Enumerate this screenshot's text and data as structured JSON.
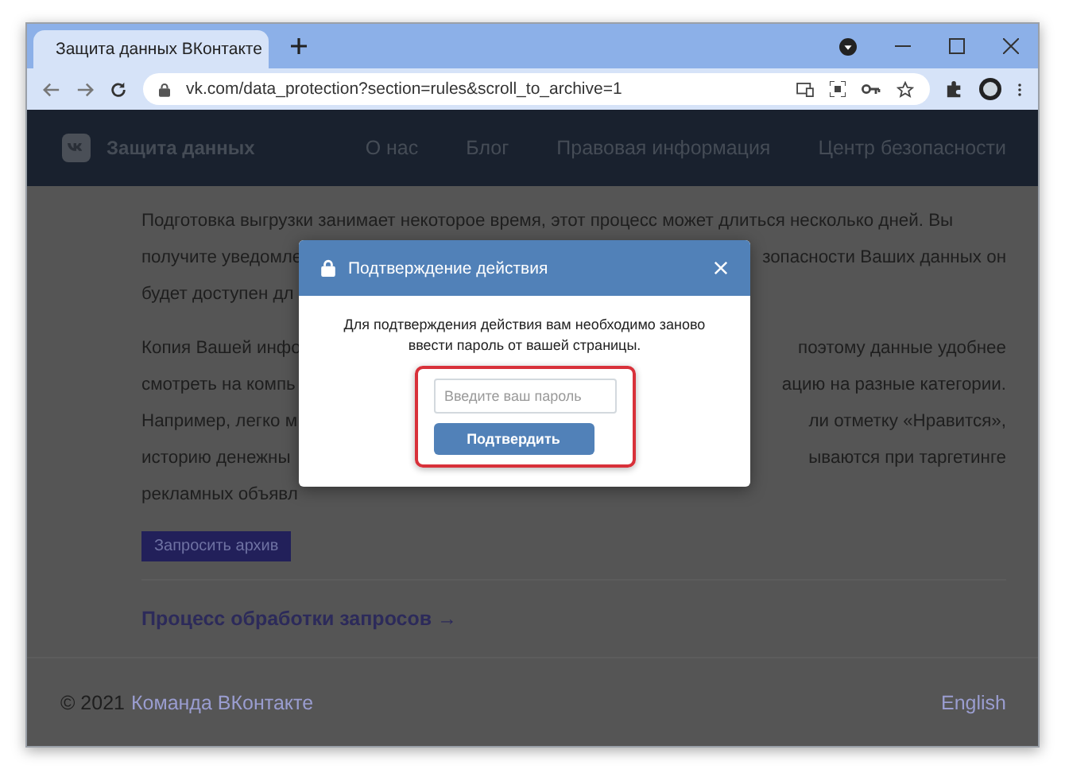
{
  "browser": {
    "tab_title": "Защита данных ВКонтакте",
    "url": "vk.com/data_protection?section=rules&scroll_to_archive=1"
  },
  "site_header": {
    "title": "Защита данных",
    "nav": [
      "О нас",
      "Блог",
      "Правовая информация",
      "Центр безопасности"
    ]
  },
  "content": {
    "paragraphs": [
      [
        {
          "left": "Подготовка выгрузки занимает некоторое время, этот процесс может длиться несколько дней. Вы"
        },
        {
          "left": "получите уведомле",
          "right": "зопасности Ваших данных он"
        },
        {
          "left": "будет доступен дл"
        }
      ],
      [
        {
          "left": "Копия Вашей инфо",
          "right": "поэтому данные удобнее"
        },
        {
          "left": "смотреть на компь",
          "right": "ацию на разные категории."
        },
        {
          "left": "Например, легко м",
          "right": "ли отметку «Нравится»,"
        },
        {
          "left": "историю денежны",
          "right": "ываются при таргетинге"
        },
        {
          "left": "рекламных объявл"
        }
      ]
    ],
    "archive_button": "Запросить архив",
    "process_link": "Процесс обработки запросов →"
  },
  "footer": {
    "copyright": "© 2021",
    "team_link": "Команда ВКонтакте",
    "language": "English"
  },
  "dialog": {
    "title": "Подтверждение действия",
    "message": "Для подтверждения действия вам необходимо заново ввести пароль от вашей страницы.",
    "password": {
      "placeholder": "Введите ваш пароль"
    },
    "confirm_button": "Подтвердить"
  }
}
